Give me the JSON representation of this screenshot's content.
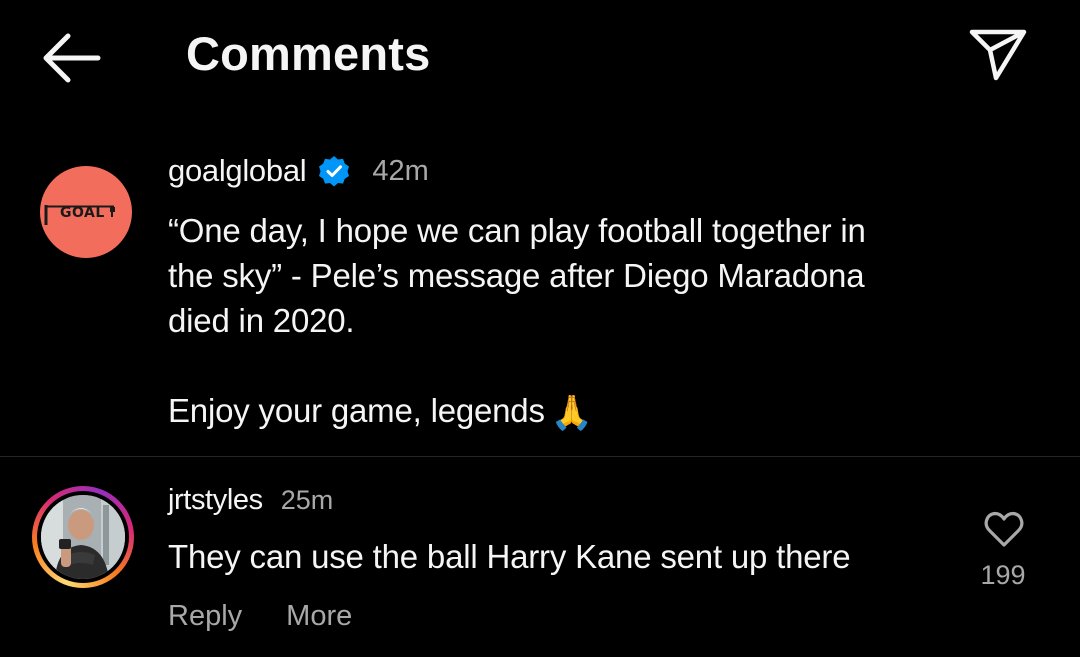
{
  "header": {
    "title": "Comments",
    "back_icon": "arrow-left-icon",
    "send_icon": "paper-plane-icon"
  },
  "caption": {
    "avatar_logo_text": "GOAL",
    "username": "goalglobal",
    "verified": true,
    "timestamp": "42m",
    "text_lines": [
      "“One day, I hope we can play football together in",
      "the sky” - Pele’s message after Diego Maradona",
      "died in 2020."
    ],
    "closing_line": "Enjoy your game, legends",
    "closing_emoji": "🙏"
  },
  "comment": {
    "username": "jrtstyles",
    "timestamp": "25m",
    "text": "They can use the ball Harry Kane sent up there",
    "reply_label": "Reply",
    "more_label": "More",
    "like_count": "199"
  },
  "colors": {
    "background": "#000000",
    "text_primary": "#f5f5f5",
    "text_secondary": "#a8a8a8",
    "goal_avatar": "#f26d5b",
    "verified_badge": "#0095f6",
    "divider": "#262626"
  }
}
